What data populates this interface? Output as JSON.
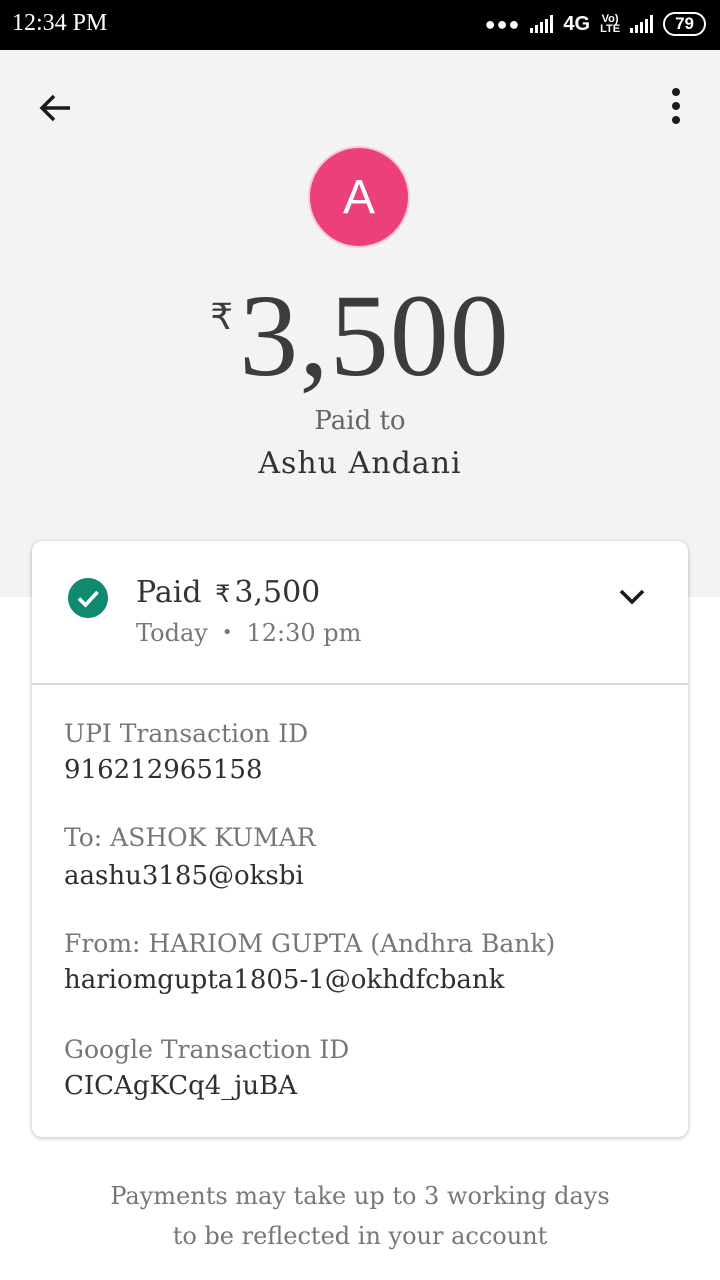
{
  "status_bar": {
    "time": "12:34 PM",
    "network": "4G",
    "volte_line1": "Vo)",
    "volte_line2": "LTE",
    "battery": "79"
  },
  "header": {
    "back_icon": "arrow-left-icon",
    "more_icon": "more-vert-icon"
  },
  "payee": {
    "avatar_letter": "A",
    "avatar_color": "#ec407a",
    "currency_symbol": "₹",
    "amount": "3,500",
    "paid_to_label": "Paid to",
    "name": "Ashu Andani"
  },
  "card": {
    "status_icon": "check-circle-icon",
    "status_color": "#0f8a6e",
    "status_prefix": "Paid",
    "currency_symbol": "₹",
    "status_amount": "3,500",
    "day": "Today",
    "separator": "•",
    "time": "12:30 pm",
    "expand_icon": "chevron-down-icon",
    "details": [
      {
        "label": "UPI Transaction ID",
        "value": "916212965158"
      },
      {
        "label": "To: ASHOK  KUMAR",
        "value": "aashu3185@oksbi"
      },
      {
        "label": "From: HARIOM GUPTA (Andhra Bank)",
        "value": "hariomgupta1805-1@okhdfcbank"
      },
      {
        "label": "Google Transaction ID",
        "value": "CICAgKCq4_juBA"
      }
    ]
  },
  "footer": {
    "line1": "Payments may take up to 3 working days",
    "line2": "to be reflected in your account"
  }
}
